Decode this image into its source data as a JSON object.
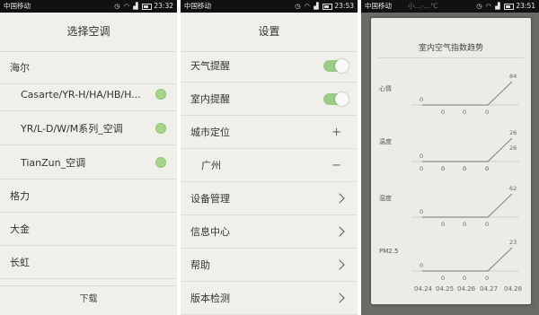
{
  "phone1": {
    "status": {
      "carrier": "中国移动",
      "time": "23:32"
    },
    "title": "选择空调",
    "rows": [
      {
        "label": "海尔",
        "type": "brand"
      },
      {
        "label": "Casarte/YR-H/HA/HB/H...",
        "type": "model"
      },
      {
        "label": "YR/L-D/W/M系列_空调",
        "type": "model"
      },
      {
        "label": "TianZun_空调",
        "type": "model"
      },
      {
        "label": "格力",
        "type": "brand"
      },
      {
        "label": "大金",
        "type": "brand"
      },
      {
        "label": "长虹",
        "type": "brand"
      }
    ],
    "download_label": "下载"
  },
  "phone2": {
    "status": {
      "carrier": "中国移动",
      "time": "23:53"
    },
    "title": "设置",
    "rows": [
      {
        "label": "天气提醒",
        "control": "toggle"
      },
      {
        "label": "室内提醒",
        "control": "toggle"
      },
      {
        "label": "城市定位",
        "control": "plus",
        "symbol": "+"
      },
      {
        "label": "广州",
        "control": "minus",
        "symbol": "−"
      },
      {
        "label": "设备管理",
        "control": "chevron"
      },
      {
        "label": "信息中心",
        "control": "chevron"
      },
      {
        "label": "帮助",
        "control": "chevron"
      },
      {
        "label": "版本检测",
        "control": "chevron"
      }
    ]
  },
  "phone3": {
    "status": {
      "carrier": "中国移动",
      "time": "23:51"
    },
    "faded_header": "小…-…℃",
    "title": "室内空气指数趋势"
  },
  "chart_data": {
    "type": "line",
    "title": "室内空气指数趋势",
    "x": [
      "04.24",
      "04.25",
      "04.26",
      "04.27",
      "04.28"
    ],
    "series": [
      {
        "name": "心情",
        "values": [
          0,
          0,
          0,
          0,
          84
        ]
      },
      {
        "name": "温度",
        "values": [
          0,
          0,
          0,
          0,
          26
        ],
        "values_secondary": [
          0,
          0,
          0,
          0,
          26
        ]
      },
      {
        "name": "湿度",
        "values": [
          0,
          0,
          0,
          0,
          62
        ]
      },
      {
        "name": "PM2.5",
        "values": [
          0,
          0,
          0,
          0,
          23
        ]
      }
    ],
    "line_color": "#8d8d8a"
  }
}
